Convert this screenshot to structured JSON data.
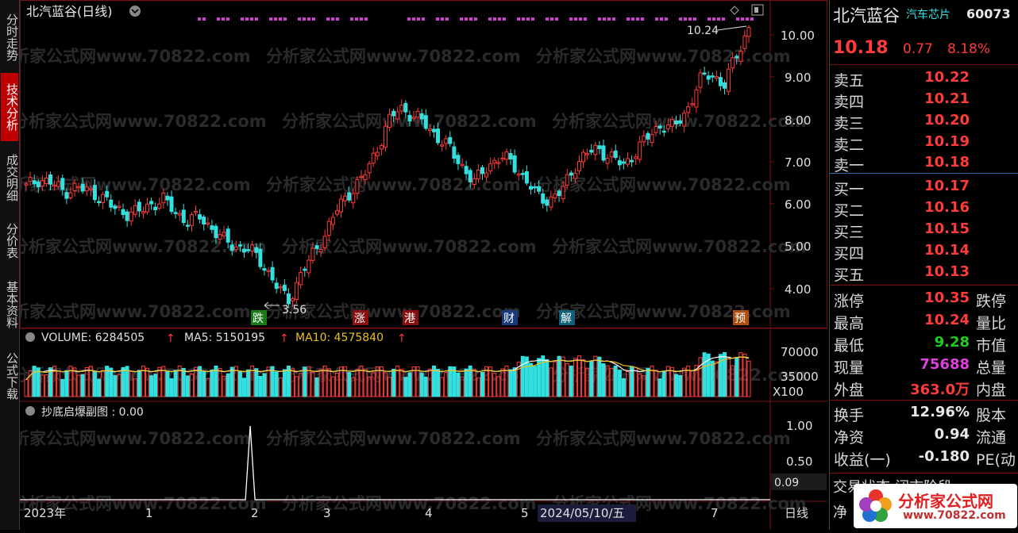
{
  "header": {
    "title": "北汽蓝谷(日线)"
  },
  "price_axis": [
    "10.00",
    "9.00",
    "8.00",
    "7.00",
    "6.00",
    "5.00",
    "4.00"
  ],
  "annotations": {
    "high": "10.24",
    "low": "3.56"
  },
  "event_badges": [
    "跌",
    "涨",
    "港",
    "财",
    "解",
    "预"
  ],
  "volume_header": {
    "volume": "VOLUME: 6284505",
    "ma5": "MA5: 5150195",
    "ma10": "MA10: 4575840"
  },
  "volume_axis": [
    "70000",
    "35000",
    "X100"
  ],
  "indicator_header": "抄底启爆副图 : 0.00",
  "indicator_axis": [
    "1.00",
    "0.50",
    "0.09"
  ],
  "time_axis": [
    "2023年",
    "1",
    "2",
    "3",
    "4",
    "5",
    "2024/05/10/五",
    "7"
  ],
  "period_label": "日线",
  "watermark": "分析家公式网www.70822.com",
  "left_tabs": [
    "分时走势",
    "技术分析",
    "成交明细",
    "分价表",
    "基本资料",
    "公式下载"
  ],
  "stock": {
    "name": "北汽蓝谷",
    "sector": "汽车芯片",
    "code": "60073",
    "price": "10.18",
    "change": "0.77",
    "pct": "8.18%"
  },
  "order_book": [
    {
      "label": "卖五",
      "price": "10.22"
    },
    {
      "label": "卖四",
      "price": "10.21"
    },
    {
      "label": "卖三",
      "price": "10.20"
    },
    {
      "label": "卖二",
      "price": "10.19"
    },
    {
      "label": "卖一",
      "price": "10.18"
    },
    {
      "label": "买一",
      "price": "10.17"
    },
    {
      "label": "买二",
      "price": "10.16"
    },
    {
      "label": "买三",
      "price": "10.15"
    },
    {
      "label": "买四",
      "price": "10.14"
    },
    {
      "label": "买五",
      "price": "10.13"
    }
  ],
  "stats": [
    {
      "label": "涨停",
      "value": "10.35",
      "label2": "跌停"
    },
    {
      "label": "最高",
      "value": "10.24",
      "label2": "量比"
    },
    {
      "label": "最低",
      "value": "9.28",
      "label2": "市值"
    },
    {
      "label": "现量",
      "value": "75688",
      "label2": "总量"
    },
    {
      "label": "外盘",
      "value": "363.0万",
      "label2": "内盘"
    }
  ],
  "stats2": [
    {
      "label": "换手",
      "value": "12.96%",
      "label2": "股本"
    },
    {
      "label": "净资",
      "value": "0.94",
      "label2": "流通"
    },
    {
      "label": "收益(一)",
      "value": "-0.180",
      "label2": "PE(动"
    }
  ],
  "status_line": "交易状态:闭市阶段",
  "status_line2": "净",
  "logo": {
    "name": "分析家公式网",
    "url": "www.70822.com"
  },
  "colors": {
    "up": "#ff3b3b",
    "down": "#33e0e0",
    "ma5": "#ffffff",
    "ma10": "#e8c020",
    "badge_magenta": "#d040d0"
  },
  "chart_data": {
    "type": "candlestick",
    "title": "北汽蓝谷(日线)",
    "price_range": [
      3.6,
      10.3
    ],
    "low_point": 3.56,
    "high_point": 10.24,
    "close_path": [
      6.4,
      6.6,
      6.5,
      6.3,
      6.4,
      6.3,
      6.2,
      5.9,
      5.8,
      5.8,
      6.0,
      6.1,
      5.8,
      5.6,
      5.7,
      5.4,
      5.1,
      5.0,
      4.9,
      4.6,
      4.1,
      3.7,
      4.3,
      4.8,
      5.3,
      5.9,
      6.3,
      6.6,
      7.2,
      7.9,
      8.3,
      8.1,
      7.9,
      7.6,
      7.3,
      6.9,
      6.5,
      6.9,
      7.1,
      7.0,
      6.6,
      6.2,
      6.1,
      6.3,
      6.9,
      7.2,
      7.3,
      7.1,
      6.9,
      7.3,
      7.6,
      7.9,
      7.8,
      8.2,
      8.9,
      9.1,
      8.8,
      9.5,
      10.18
    ],
    "volume_range": [
      0,
      70000
    ],
    "indicator_spike_x_fraction": 0.31
  }
}
